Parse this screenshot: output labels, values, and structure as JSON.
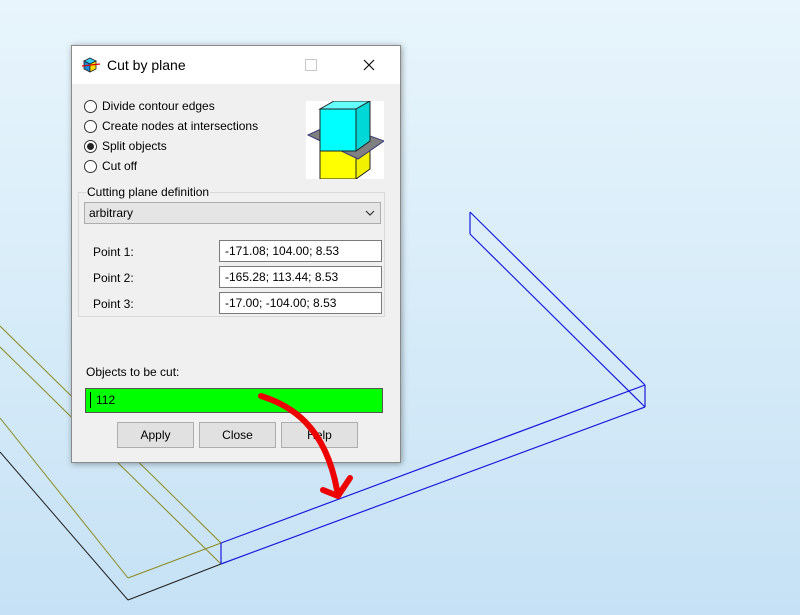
{
  "dialog": {
    "title": "Cut by plane",
    "options": [
      {
        "label": "Divide contour edges",
        "checked": false
      },
      {
        "label": "Create nodes at intersections",
        "checked": false
      },
      {
        "label": "Split objects",
        "checked": true
      },
      {
        "label": "Cut off",
        "checked": false
      }
    ],
    "plane_group": {
      "legend": "Cutting plane definition",
      "mode": "arbitrary",
      "points": [
        {
          "label": "Point 1:",
          "value": "-171.08; 104.00; 8.53"
        },
        {
          "label": "Point 2:",
          "value": "-165.28; 113.44; 8.53"
        },
        {
          "label": "Point 3:",
          "value": "-17.00; -104.00; 8.53"
        }
      ]
    },
    "objects": {
      "label": "Objects to be cut:",
      "value": "112",
      "highlight_color": "#00ff00"
    },
    "buttons": {
      "apply": "Apply",
      "close": "Close",
      "help": "Help"
    }
  },
  "colors": {
    "selected_edges": "#1a1adb",
    "edges_olive": "#8a8a1e",
    "annotation_arrow": "#ee0000",
    "preview_top": "#00ffff",
    "preview_bottom": "#ffff00",
    "preview_plane": "#808080"
  }
}
